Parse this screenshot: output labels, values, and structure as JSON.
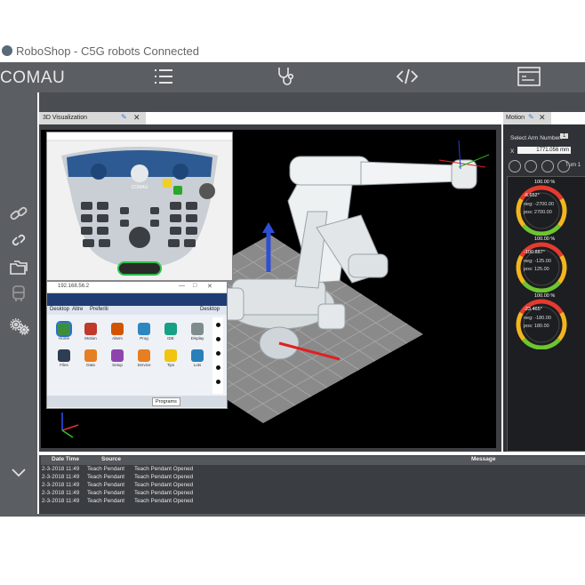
{
  "window": {
    "title": "RoboShop - C5G robots Connected"
  },
  "toolbar": {
    "brand": "COMAU",
    "icons": [
      "menu-list-icon",
      "stethoscope-icon",
      "code-icon",
      "terminal-icon"
    ]
  },
  "left_rail": {
    "icons": [
      "link-icon",
      "unlink-icon",
      "folders-icon",
      "robot-cabinet-icon",
      "settings-gears-icon"
    ],
    "expand_icon": "chevron-down-icon"
  },
  "panels": {
    "viz_title": "3D Visualization",
    "motion_title": "Motion"
  },
  "motion": {
    "select_arm_label": "Select Arm Number:",
    "arm_number": "1",
    "axis_label": "X",
    "axis_value": "1771.056 mm",
    "turn_label": "Turn 1",
    "joints": [
      {
        "pct": "100.00 %",
        "value": "-6.652°",
        "neg": "neg: -2700.00",
        "pos": "pos: 2700.00",
        "fill": 0.5
      },
      {
        "pct": "100.00 %",
        "value": "-100.887°",
        "neg": "neg: -125.00",
        "pos": "pos: 125.00",
        "fill": 0.12
      },
      {
        "pct": "100.00 %",
        "value": "-23.465°",
        "neg": "neg: -180.00",
        "pos": "pos: 180.00",
        "fill": 0.45
      }
    ]
  },
  "hmi": {
    "ip": "192.168.56.2",
    "tabs": [
      "Desktop",
      "Altre",
      "Preferiti"
    ],
    "desktop_label": "Desktop",
    "apps": [
      "Home",
      "Motion",
      "Alarm",
      "Prog",
      "IDE",
      "Display",
      "Files",
      "Data",
      "Setup",
      "Service",
      "Tips",
      "Lots"
    ],
    "footer_button": "Programs"
  },
  "teach_pendant": {
    "brand": "COMAU"
  },
  "log": {
    "headers": [
      "Date Time",
      "Source",
      "Message"
    ],
    "rows": [
      [
        "2-3-2018 11:49",
        "Teach Pendant",
        "Teach Pendant Opened"
      ],
      [
        "2-3-2018 11:49",
        "Teach Pendant",
        "Teach Pendant Opened"
      ],
      [
        "2-3-2018 11:49",
        "Teach Pendant",
        "Teach Pendant Opened"
      ],
      [
        "2-3-2018 11:49",
        "Teach Pendant",
        "Teach Pendant Opened"
      ],
      [
        "2-3-2018 11:49",
        "Teach Pendant",
        "Teach Pendant Opened"
      ]
    ]
  }
}
